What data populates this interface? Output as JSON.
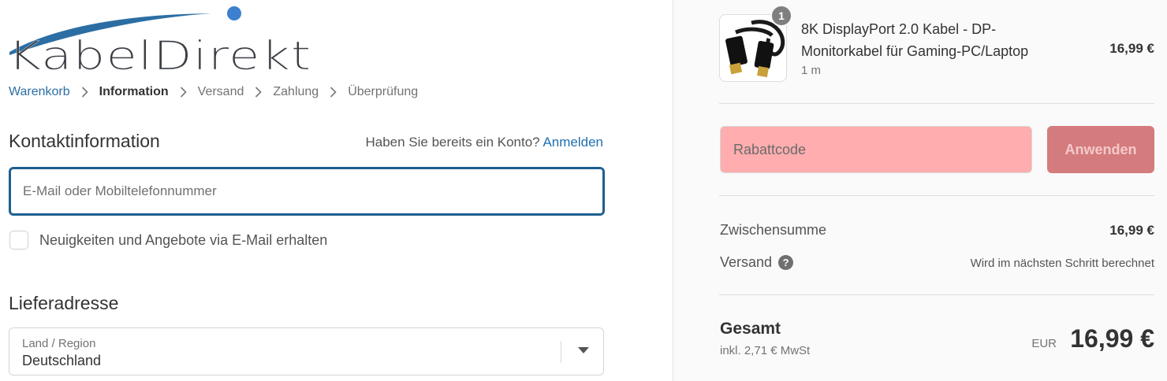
{
  "brand": {
    "logo_text": "KabelDirekt",
    "logo_colors": {
      "text": "#3b3f45",
      "swoosh": "#2c6ea3",
      "dot": "#3d7fd1"
    }
  },
  "breadcrumb": [
    {
      "label": "Warenkorb",
      "state": "link"
    },
    {
      "label": "Information",
      "state": "current"
    },
    {
      "label": "Versand",
      "state": "upcoming"
    },
    {
      "label": "Zahlung",
      "state": "upcoming"
    },
    {
      "label": "Überprüfung",
      "state": "upcoming"
    }
  ],
  "contact": {
    "title": "Kontaktinformation",
    "login_prompt": "Haben Sie bereits ein Konto?",
    "login_link": "Anmelden",
    "email_placeholder": "E-Mail oder Mobiltelefonnummer",
    "email_value": "",
    "newsletter_label": "Neuigkeiten und Angebote via E-Mail erhalten",
    "newsletter_checked": false
  },
  "shipping": {
    "title": "Lieferadresse",
    "country_label": "Land / Region",
    "country_value": "Deutschland"
  },
  "cart": {
    "item": {
      "quantity": "1",
      "name": "8K DisplayPort 2.0 Kabel - DP-Monitorkabel für Gaming-PC/Laptop",
      "variant": "1 m",
      "price": "16,99 €"
    },
    "discount": {
      "placeholder": "Rabattcode",
      "button_label": "Anwenden"
    },
    "subtotal_label": "Zwischensumme",
    "subtotal_value": "16,99 €",
    "shipping_label": "Versand",
    "shipping_value": "Wird im nächsten Schritt berechnet",
    "total_label": "Gesamt",
    "tax_note": "inkl. 2,71 € MwSt",
    "currency": "EUR",
    "total_value": "16,99 €"
  },
  "colors": {
    "accent": "#1f6fae",
    "discount_field_bg": "#ffadae",
    "discount_button_bg": "#d47b7d"
  }
}
